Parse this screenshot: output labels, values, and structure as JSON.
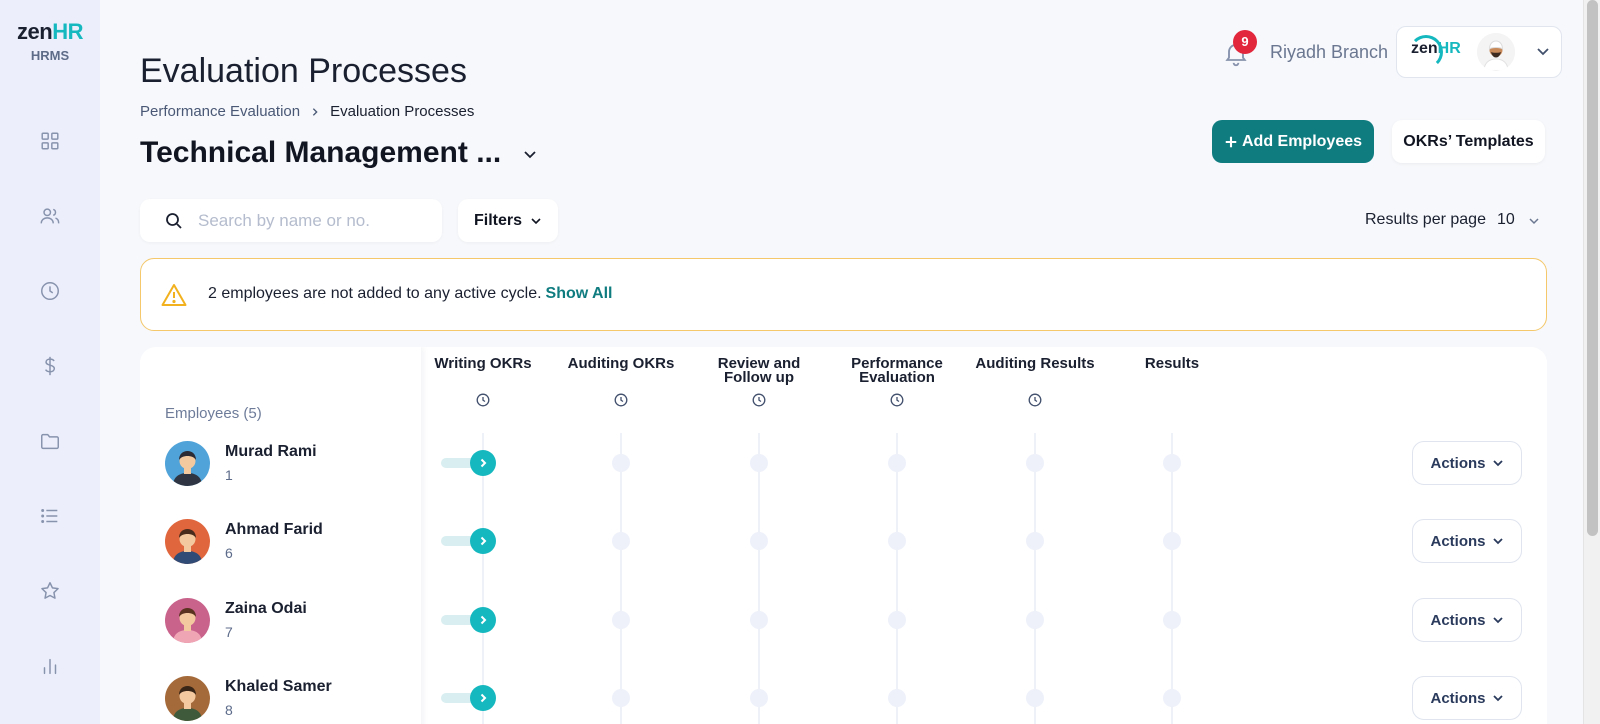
{
  "brand": {
    "logo_main": "zen",
    "logo_accent": "HR",
    "subtitle": "HRMS"
  },
  "sidebar": {
    "items": [
      {
        "icon": "dashboard-icon"
      },
      {
        "icon": "users-icon"
      },
      {
        "icon": "clock-icon"
      },
      {
        "icon": "dollar-icon"
      },
      {
        "icon": "folder-icon"
      },
      {
        "icon": "list-icon"
      },
      {
        "icon": "star-icon"
      },
      {
        "icon": "bar-chart-icon"
      }
    ]
  },
  "header": {
    "notification_count": "9",
    "branch": "Riyadh Branch",
    "profile_logo_main": "zen",
    "profile_logo_accent": "HR"
  },
  "page": {
    "title": "Evaluation Processes",
    "breadcrumb": {
      "parent": "Performance Evaluation",
      "current": "Evaluation Processes"
    },
    "process_name": "Technical Management ...",
    "add_button": "Add Employees",
    "templates_button": "OKRs’ Templates"
  },
  "toolbar": {
    "search_placeholder": "Search by name or no.",
    "search_value": "",
    "filters_label": "Filters",
    "results_per_page_label": "Results per page",
    "results_per_page_value": "10"
  },
  "alert": {
    "text": "2 employees are not added to any active cycle.",
    "link": "Show All",
    "accent": "#f4c86b"
  },
  "table": {
    "employees_header": "Employees (5)",
    "stages": [
      {
        "line1": "Writing OKRs",
        "line2": "",
        "timed": true
      },
      {
        "line1": "Auditing OKRs",
        "line2": "",
        "timed": true
      },
      {
        "line1": "Review and",
        "line2": "Follow up",
        "timed": true
      },
      {
        "line1": "Performance",
        "line2": "Evaluation",
        "timed": true
      },
      {
        "line1": "Auditing Results",
        "line2": "",
        "timed": true
      },
      {
        "line1": "Results",
        "line2": "",
        "timed": false
      }
    ],
    "rows": [
      {
        "name": "Murad Rami",
        "number": "1",
        "current_stage": 1,
        "actions": "Actions"
      },
      {
        "name": "Ahmad Farid",
        "number": "6",
        "current_stage": 1,
        "actions": "Actions"
      },
      {
        "name": "Zaina Odai",
        "number": "7",
        "current_stage": 1,
        "actions": "Actions"
      },
      {
        "name": "Khaled Samer",
        "number": "8",
        "current_stage": 1,
        "actions": "Actions"
      }
    ]
  },
  "colors": {
    "primary": "#0f7c80",
    "accent": "#16b8bf",
    "badge": "#e2263b"
  }
}
